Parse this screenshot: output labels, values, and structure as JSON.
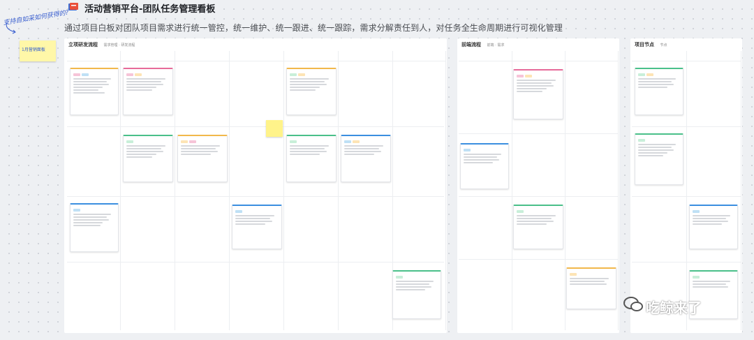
{
  "header": {
    "title": "活动营销平台-团队任务管理看板",
    "subtitle": "通过项目白板对团队项目需求进行统一管控，统一维护、统一跟进、统一跟踪，需求分解责任到人，对任务全生命周期进行可视化管理"
  },
  "annotation": {
    "handwritten": "支持自如采如何获得的?",
    "sticky": "1月营销面板"
  },
  "boards": [
    {
      "title": "立项研发流程",
      "meta": "需求管理 · 研发流程"
    },
    {
      "title": "前端流程",
      "meta": "前端 · 需求"
    },
    {
      "title": "项目节点",
      "meta": "节点"
    }
  ],
  "watermark": "吃鲸来了",
  "colors": {
    "card_orange": "#f2b84b",
    "card_pink": "#e76b9a",
    "card_green": "#4ac08a",
    "card_blue": "#3b8fe0",
    "sticky": "#fff7a8"
  }
}
